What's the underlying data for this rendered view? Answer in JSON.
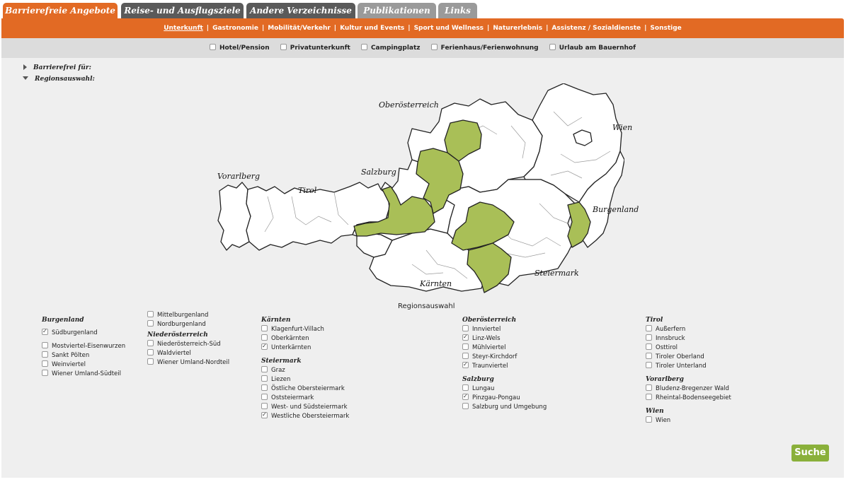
{
  "tabs": [
    "Barrierefreie Angebote",
    "Reise- und Ausflugsziele",
    "Andere Verzeichnisse",
    "Publikationen",
    "Links"
  ],
  "subnav": [
    "Unterkunft",
    "Gastronomie",
    "Mobilität/Verkehr",
    "Kultur und Events",
    "Sport und Wellness",
    "Naturerlebnis",
    "Assistenz / Sozialdienste",
    "Sonstige"
  ],
  "accommodation_types": [
    "Hotel/Pension",
    "Privatunterkunft",
    "Campingplatz",
    "Ferienhaus/Ferienwohnung",
    "Urlaub am Bauernhof"
  ],
  "toggles": {
    "barrierefrei": "Barrierefrei für:",
    "region": "Regionsauswahl:"
  },
  "map_labels": {
    "oberoesterreich": "Oberösterreich",
    "wien": "Wien",
    "vorarlberg": "Vorarlberg",
    "tirol": "Tirol",
    "salzburg": "Salzburg",
    "burgenland": "Burgenland",
    "steiermark": "Steiermark",
    "kaernten": "Kärnten"
  },
  "region_title": "Regionsauswahl",
  "groups": {
    "burgenland": {
      "label": "Burgenland",
      "items": [
        {
          "label": "Südburgenland",
          "checked": true
        },
        {
          "label": "Mostviertel-Eisenwurzen",
          "checked": false
        },
        {
          "label": "Sankt Pölten",
          "checked": false
        },
        {
          "label": "Weinviertel",
          "checked": false
        },
        {
          "label": "Wiener Umland-Südteil",
          "checked": false
        }
      ]
    },
    "burgenland_extra": {
      "items": [
        {
          "label": "Mittelburgenland",
          "checked": false
        },
        {
          "label": "Nordburgenland",
          "checked": false
        }
      ]
    },
    "niederoesterreich": {
      "label": "Niederösterreich",
      "items": [
        {
          "label": "Niederösterreich-Süd",
          "checked": false
        },
        {
          "label": "Waldviertel",
          "checked": false
        },
        {
          "label": "Wiener Umland-Nordteil",
          "checked": false
        }
      ]
    },
    "kaernten": {
      "label": "Kärnten",
      "items": [
        {
          "label": "Klagenfurt-Villach",
          "checked": false
        },
        {
          "label": "Oberkärnten",
          "checked": false
        },
        {
          "label": "Unterkärnten",
          "checked": true
        }
      ]
    },
    "steiermark": {
      "label": "Steiermark",
      "items": [
        {
          "label": "Graz",
          "checked": false
        },
        {
          "label": "Liezen",
          "checked": false
        },
        {
          "label": "Östliche Obersteiermark",
          "checked": false
        },
        {
          "label": "Oststeiermark",
          "checked": false
        },
        {
          "label": "West- und Südsteiermark",
          "checked": false
        },
        {
          "label": "Westliche Obersteiermark",
          "checked": true
        }
      ]
    },
    "oberoesterreich": {
      "label": "Oberösterreich",
      "items": [
        {
          "label": "Innviertel",
          "checked": false
        },
        {
          "label": "Linz-Wels",
          "checked": true
        },
        {
          "label": "Mühlviertel",
          "checked": false
        },
        {
          "label": "Steyr-Kirchdorf",
          "checked": false
        },
        {
          "label": "Traunviertel",
          "checked": true
        }
      ]
    },
    "salzburg": {
      "label": "Salzburg",
      "items": [
        {
          "label": "Lungau",
          "checked": false
        },
        {
          "label": "Pinzgau-Pongau",
          "checked": true
        },
        {
          "label": "Salzburg und Umgebung",
          "checked": false
        }
      ]
    },
    "tirol": {
      "label": "Tirol",
      "items": [
        {
          "label": "Außerfern",
          "checked": false
        },
        {
          "label": "Innsbruck",
          "checked": false
        },
        {
          "label": "Osttirol",
          "checked": false
        },
        {
          "label": "Tiroler Oberland",
          "checked": false
        },
        {
          "label": "Tiroler Unterland",
          "checked": false
        }
      ]
    },
    "vorarlberg": {
      "label": "Vorarlberg",
      "items": [
        {
          "label": "Bludenz-Bregenzer Wald",
          "checked": false
        },
        {
          "label": "Rheintal-Bodenseegebiet",
          "checked": false
        }
      ]
    },
    "wien": {
      "label": "Wien",
      "items": [
        {
          "label": "Wien",
          "checked": false
        }
      ]
    }
  },
  "search_button": "Suche",
  "colors": {
    "accent": "#e26a24",
    "selected_region": "#a9bf57",
    "button": "#8ab03a"
  }
}
